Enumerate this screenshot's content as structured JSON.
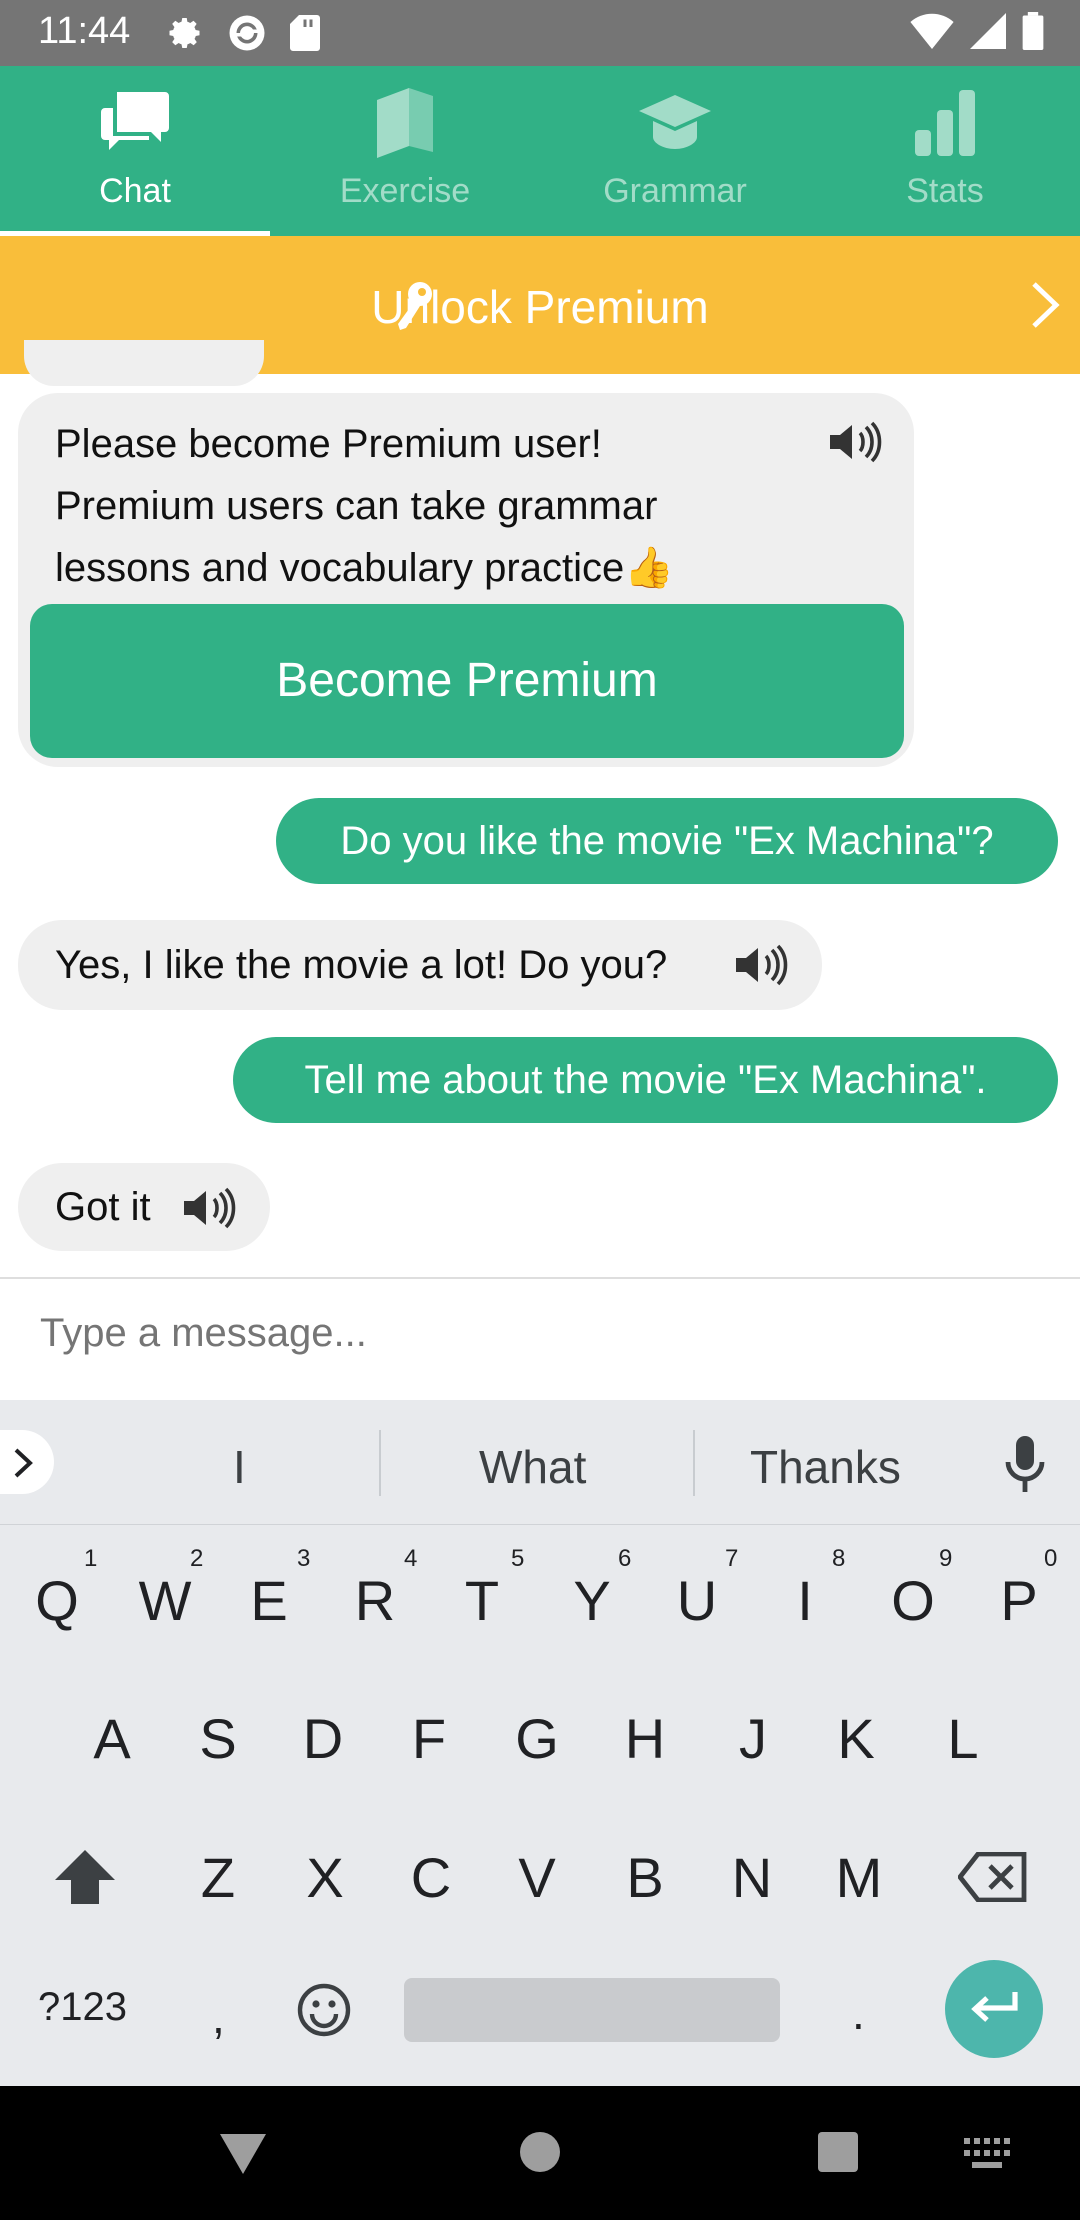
{
  "status_bar": {
    "time": "11:44"
  },
  "tabs": [
    {
      "label": "Chat",
      "icon": "chat-icon",
      "active": true
    },
    {
      "label": "Exercise",
      "icon": "book-icon",
      "active": false
    },
    {
      "label": "Grammar",
      "icon": "graduation-cap-icon",
      "active": false
    },
    {
      "label": "Stats",
      "icon": "bar-chart-icon",
      "active": false
    }
  ],
  "banner": {
    "label": "Unlock Premium"
  },
  "chat": {
    "premium_message": {
      "line1": "Please become Premium user!",
      "line2": "Premium users can take grammar",
      "line3": "lessons and vocabulary practice",
      "emoji": "👍",
      "button": "Become Premium"
    },
    "messages": [
      {
        "from": "user",
        "text": "Do you like the movie \"Ex Machina\"?"
      },
      {
        "from": "bot",
        "text": "Yes, I like the movie a lot! Do you?"
      },
      {
        "from": "user",
        "text": "Tell me about the movie \"Ex Machina\"."
      },
      {
        "from": "bot",
        "text": "Got it"
      }
    ]
  },
  "composer": {
    "placeholder": "Type a message..."
  },
  "keyboard": {
    "suggestions": [
      "I",
      "What",
      "Thanks"
    ],
    "row1": [
      "Q",
      "W",
      "E",
      "R",
      "T",
      "Y",
      "U",
      "I",
      "O",
      "P"
    ],
    "row1_hints": [
      "1",
      "2",
      "3",
      "4",
      "5",
      "6",
      "7",
      "8",
      "9",
      "0"
    ],
    "row2": [
      "A",
      "S",
      "D",
      "F",
      "G",
      "H",
      "J",
      "K",
      "L"
    ],
    "row3": [
      "Z",
      "X",
      "C",
      "V",
      "B",
      "N",
      "M"
    ],
    "symbols": "?123",
    "comma": ",",
    "period": "."
  },
  "colors": {
    "primary": "#31b186",
    "banner": "#f9be3a",
    "bubble_in": "#efefef"
  }
}
